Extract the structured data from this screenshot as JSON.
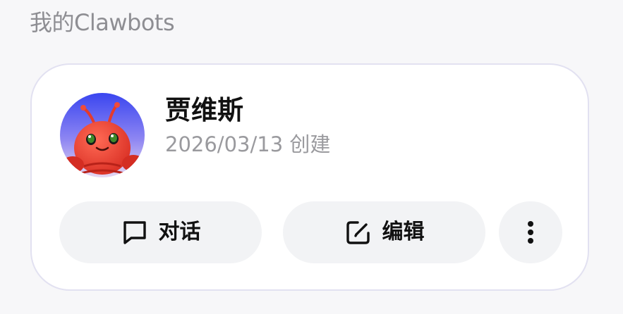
{
  "section": {
    "title": "我的Clawbots"
  },
  "card": {
    "name": "贾维斯",
    "created": "2026/03/13 创建",
    "avatar_icon": "red-robot-mascot",
    "actions": {
      "chat": {
        "label": "对话",
        "icon": "chat-bubble-icon"
      },
      "edit": {
        "label": "编辑",
        "icon": "edit-square-icon"
      },
      "more": {
        "icon": "more-vertical-icon"
      }
    }
  },
  "colors": {
    "page_bg": "#f7f7f9",
    "card_border": "#e2e1f1",
    "button_bg": "#f2f3f5",
    "muted_text": "#9a9a9e"
  }
}
